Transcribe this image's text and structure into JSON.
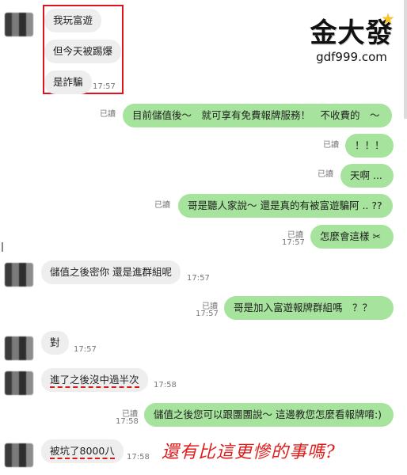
{
  "logo": {
    "brand": "金大發",
    "site": "gdf999.com"
  },
  "caption": "還有比這更慘的事嗎?",
  "messages": {
    "m1": {
      "text": "我玩富遊"
    },
    "m2": {
      "text": "但今天被踢爆"
    },
    "m3": {
      "text": "是詐騙",
      "time": "17:57"
    },
    "s1": {
      "text": "目前儲值後～　就可享有免費報牌服務！　不收費的　～",
      "read": "已讀"
    },
    "s2": {
      "text": "！！！",
      "read": "已讀"
    },
    "s3": {
      "text": "天啊 ...",
      "read": "已讀"
    },
    "s4": {
      "text": "哥是聽人家說～ 還是真的有被富遊騙阿 .. ??",
      "read": "已讀"
    },
    "s5": {
      "text": "怎麼會這樣  ✂",
      "read": "已讀",
      "time": "17:57"
    },
    "r1": {
      "text": "儲值之後密你 還是進群組呢",
      "time": "17:57"
    },
    "s6": {
      "text": "哥是加入富遊報牌群組嗎　？？",
      "read": "已讀",
      "time": "17:57"
    },
    "r2": {
      "text": "對",
      "time": "17:57"
    },
    "r3": {
      "text": "進了之後沒中過半次",
      "time": "17:58"
    },
    "s7": {
      "text": "儲值之後您可以跟團團說～ 這邊教您怎麼看報牌唷:)",
      "read": "已讀",
      "time": "17:58"
    },
    "r4": {
      "text": "被坑了8000八",
      "time": "17:58"
    }
  }
}
